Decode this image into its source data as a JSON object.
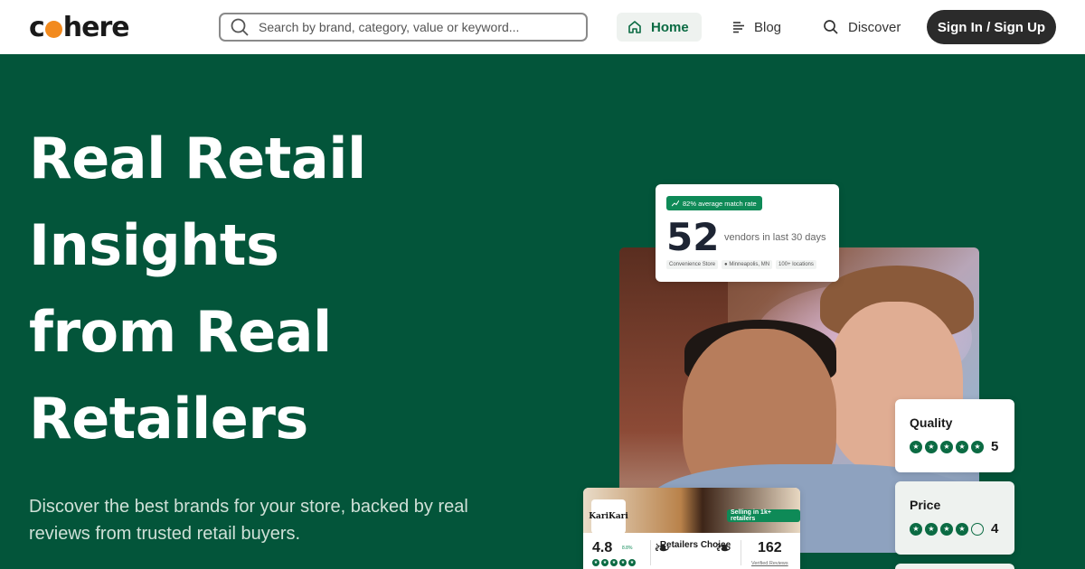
{
  "header": {
    "logo_text_before": "c",
    "logo_text_after": "here",
    "search_placeholder": "Search by brand, category, value or keyword...",
    "nav": {
      "home": "Home",
      "blog": "Blog",
      "discover": "Discover"
    },
    "signin_label": "Sign In / Sign Up"
  },
  "hero": {
    "title_lines": [
      "Real Retail",
      "Insights",
      "from Real",
      "Retailers"
    ],
    "subtitle": "Discover the best brands for your store, backed by real reviews from trusted retail buyers."
  },
  "vendor_card": {
    "badge": "82% average match rate",
    "number": "52",
    "label": "vendors in last 30 days",
    "meta": [
      "Convenience Store",
      "Minneapolis, MN",
      "100+ locations"
    ]
  },
  "ratings": [
    {
      "title": "Quality",
      "value": "5",
      "stars_filled": 5
    },
    {
      "title": "Price",
      "value": "4",
      "stars_filled": 4
    }
  ],
  "brand_card": {
    "logo": "KariKari",
    "selling_badge": "Selling in 1k+ retailers",
    "score": "4.8",
    "delta": "8.8%",
    "retailers_choice": "Retailers Choice",
    "reviews_count": "162",
    "reviews_label": "Verified Reviews"
  },
  "colors": {
    "hero_bg": "#03553a",
    "accent_green": "#0b6b43",
    "logo_orange": "#f28a1e",
    "signin_bg": "#2b2b2b"
  }
}
